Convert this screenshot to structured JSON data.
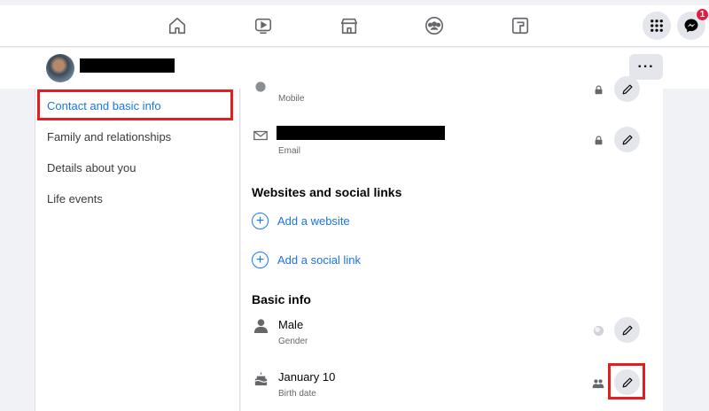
{
  "topnav": {
    "icons": [
      "home-icon",
      "watch-icon",
      "marketplace-icon",
      "groups-icon",
      "gaming-icon"
    ],
    "menu_icon": "grid-menu-icon",
    "messenger_icon": "messenger-icon",
    "messenger_badge": "1"
  },
  "profile": {
    "more_label": "···"
  },
  "sidebar": {
    "items": [
      {
        "label": "Contact and basic info",
        "active": true
      },
      {
        "label": "Family and relationships"
      },
      {
        "label": "Details about you"
      },
      {
        "label": "Life events"
      }
    ]
  },
  "contact": {
    "mobile_sub": "Mobile",
    "email_sub": "Email"
  },
  "websites": {
    "title": "Websites and social links",
    "add_website": "Add a website",
    "add_social": "Add a social link"
  },
  "basic": {
    "title": "Basic info",
    "gender_value": "Male",
    "gender_sub": "Gender",
    "birth_value": "January 10",
    "birth_sub": "Birth date"
  },
  "colors": {
    "accent": "#1877f2",
    "highlight": "#e02020",
    "badge": "#e41e3f"
  }
}
